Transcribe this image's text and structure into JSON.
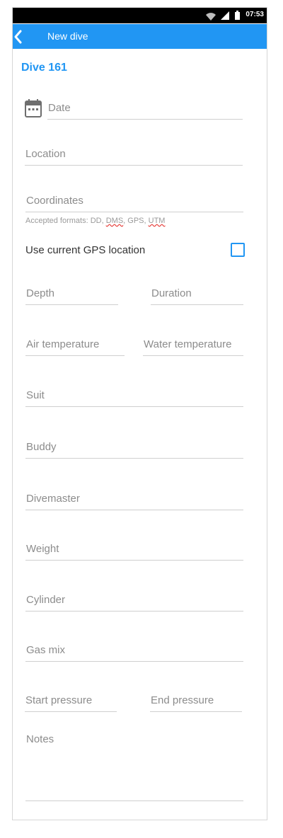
{
  "status_bar": {
    "time": "07:53"
  },
  "app_bar": {
    "title": "New dive"
  },
  "dive_title": "Dive 161",
  "fields": {
    "date": "Date",
    "location": "Location",
    "coordinates": "Coordinates",
    "coordinates_helper": {
      "prefix": "Accepted formats: DD, ",
      "dms": "DMS",
      "sep": ", GPS, ",
      "utm": "UTM"
    },
    "use_gps": "Use current GPS location",
    "depth": "Depth",
    "duration": "Duration",
    "air_temperature": "Air temperature",
    "water_temperature": "Water temperature",
    "suit": "Suit",
    "buddy": "Buddy",
    "divemaster": "Divemaster",
    "weight": "Weight",
    "cylinder": "Cylinder",
    "gas_mix": "Gas mix",
    "start_pressure": "Start pressure",
    "end_pressure": "End pressure",
    "notes": "Notes"
  },
  "colors": {
    "accent": "#2196f3",
    "status_bar": "#000000",
    "label": "#8c8c8c",
    "divider": "#cfcfcf"
  },
  "icons": {
    "back": "chevron-left-icon",
    "date": "calendar-icon",
    "wifi": "wifi-icon",
    "signal": "signal-icon",
    "battery": "battery-icon"
  }
}
